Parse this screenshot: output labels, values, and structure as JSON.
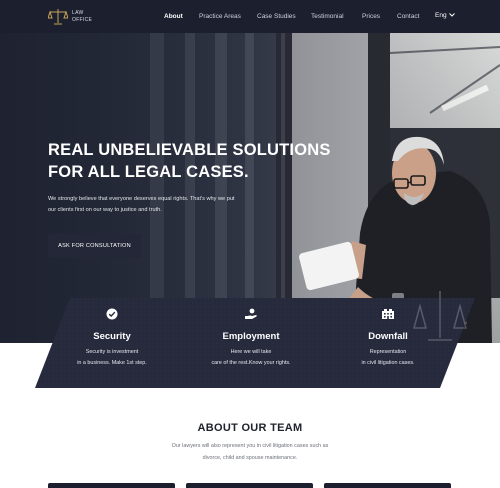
{
  "brand": {
    "line1": "LAW",
    "line2": "OFFICE"
  },
  "nav": {
    "items": [
      {
        "label": "About",
        "active": true
      },
      {
        "label": "Practice Areas",
        "active": false
      },
      {
        "label": "Case Studies",
        "active": false
      },
      {
        "label": "Testimonial",
        "active": false
      },
      {
        "label": "Prices",
        "active": false
      },
      {
        "label": "Contact",
        "active": false
      }
    ],
    "language": "Eng"
  },
  "hero": {
    "title_line1": "REAL UNBELIEVABLE SOLUTIONS",
    "title_line2": "FOR ALL LEGAL CASES.",
    "subtitle_line1": "We strongly believe that everyone deserves equal rights. That's why we put",
    "subtitle_line2": "our clients first on our way to justice and truth.",
    "cta_label": "ASK FOR CONSULTATION"
  },
  "features": [
    {
      "icon": "check-circle-icon",
      "title": "Security",
      "text_line1": "Security is investment",
      "text_line2": "in a business. Make 1st step."
    },
    {
      "icon": "hand-coin-icon",
      "title": "Employment",
      "text_line1": "Here we will take",
      "text_line2": "care of the rest.Know your rights."
    },
    {
      "icon": "building-icon",
      "title": "Downfall",
      "text_line1": "Representation",
      "text_line2": "in civil litigation cases."
    }
  ],
  "about": {
    "title": "ABOUT OUR TEAM",
    "text_line1": "Our lawyers will also represent you in civil litigation cases such as",
    "text_line2": "divorce, child and spouse maintenance."
  },
  "colors": {
    "navy": "#1c1f2d",
    "band": "#262a3c",
    "white": "#ffffff"
  }
}
